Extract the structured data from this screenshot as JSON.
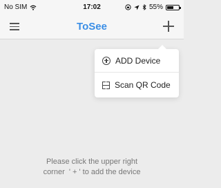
{
  "status_bar": {
    "carrier": "No SIM",
    "time": "17:02",
    "battery": "55%",
    "battery_level": 0.55
  },
  "nav": {
    "title": "ToSee",
    "title_color": "#3a8ee6"
  },
  "menu": {
    "items": [
      {
        "label": "ADD Device",
        "icon": "circle-plus-icon"
      },
      {
        "label": "Scan QR Code",
        "icon": "scan-icon"
      }
    ]
  },
  "hint": {
    "line1": "Please click the upper right",
    "line2": "corner  ' + ' to add the device"
  }
}
